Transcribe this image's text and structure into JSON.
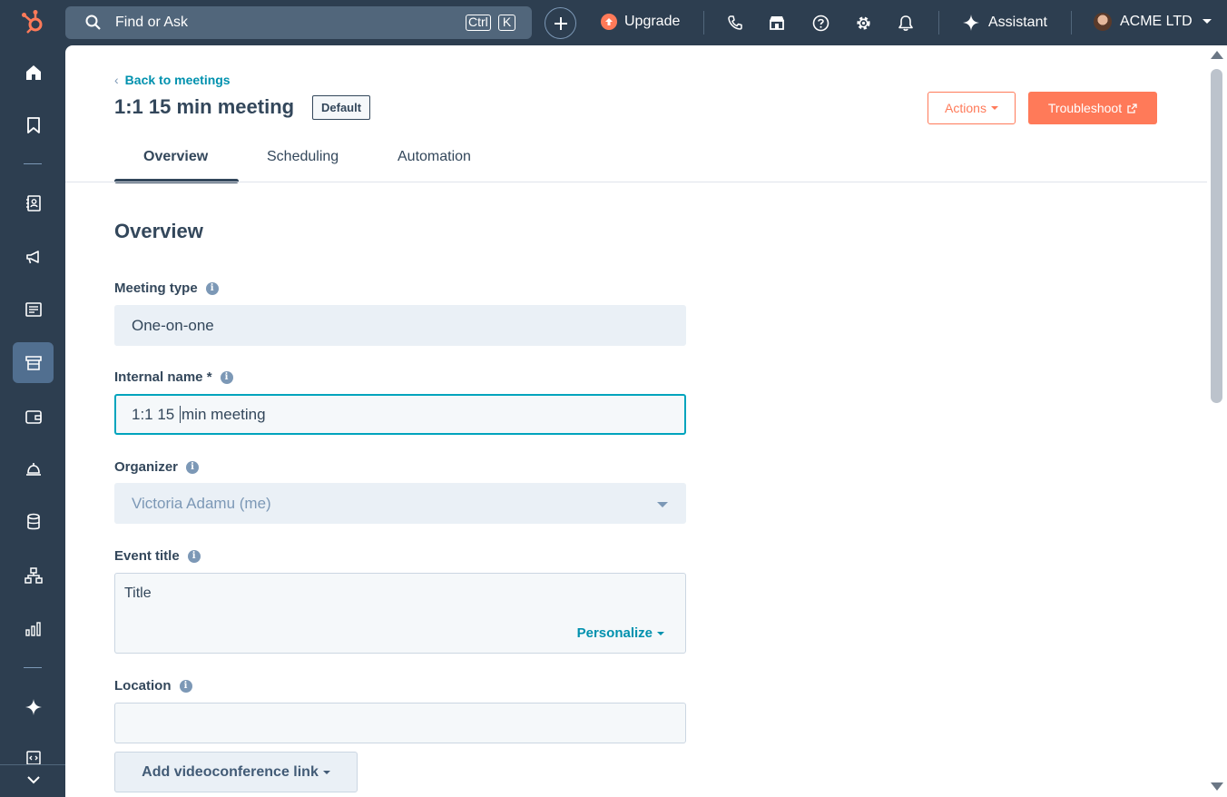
{
  "topbar": {
    "search_placeholder": "Find or Ask",
    "kbd_ctrl": "Ctrl",
    "kbd_k": "K",
    "upgrade_label": "Upgrade",
    "assistant_label": "Assistant",
    "account_name": "ACME LTD",
    "icons": [
      "phone-icon",
      "marketplace-icon",
      "help-icon",
      "settings-icon",
      "notifications-icon"
    ]
  },
  "sidebar": {
    "items": [
      "home",
      "bookmarks",
      "contacts",
      "marketing",
      "content",
      "commerce",
      "sales",
      "service",
      "data-management",
      "automation",
      "reporting",
      "ai-tools",
      "development"
    ],
    "active_item": "commerce"
  },
  "header": {
    "back_link": "Back to meetings",
    "title": "1:1 15 min meeting",
    "badge": "Default",
    "actions_button": "Actions",
    "troubleshoot_button": "Troubleshoot"
  },
  "tabs": [
    {
      "label": "Overview",
      "active": true
    },
    {
      "label": "Scheduling",
      "active": false
    },
    {
      "label": "Automation",
      "active": false
    }
  ],
  "form": {
    "section_title": "Overview",
    "meeting_type": {
      "label": "Meeting type",
      "value": "One-on-one"
    },
    "internal_name": {
      "label": "Internal name *",
      "value_before_cursor": "1:1 15 ",
      "value_after_cursor": "min meeting"
    },
    "organizer": {
      "label": "Organizer",
      "value": "Victoria Adamu (me)"
    },
    "event_title": {
      "label": "Event title",
      "value": "Title",
      "personalize_label": "Personalize"
    },
    "location": {
      "label": "Location",
      "value": ""
    },
    "videoconference_button": "Add videoconference link"
  },
  "colors": {
    "nav_bg": "#2d3e50",
    "accent_orange": "#ff7a59",
    "link_teal": "#0091ae",
    "focus_teal": "#00a4bd"
  }
}
